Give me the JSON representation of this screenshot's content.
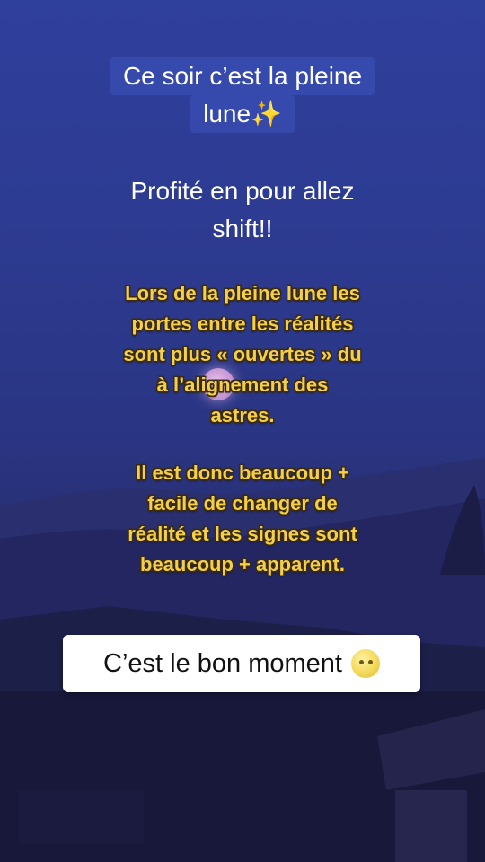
{
  "caption": {
    "line1": "Ce soir c’est la pleine",
    "line2": "lune✨",
    "line3": "Profité en pour allez",
    "line4": "shift!!"
  },
  "paragraph1": [
    "Lors de la pleine lune les",
    "portes entre les réalités",
    "sont plus « ouvertes » du",
    "à l’alignement des",
    "astres."
  ],
  "paragraph2": [
    "Il est donc beaucoup +",
    "facile de changer de",
    "réalité et les signes sont",
    "beaucoup + apparent."
  ],
  "sticker": {
    "text": "C’est le bon moment"
  },
  "icons": {
    "sticker_emoji": "full-moon-face-icon",
    "sparkles": "sparkles-emoji"
  },
  "colors": {
    "sky_top": "#2f3f9c",
    "yellow_text": "#f4d04a",
    "caption_box": "#3e54be"
  }
}
